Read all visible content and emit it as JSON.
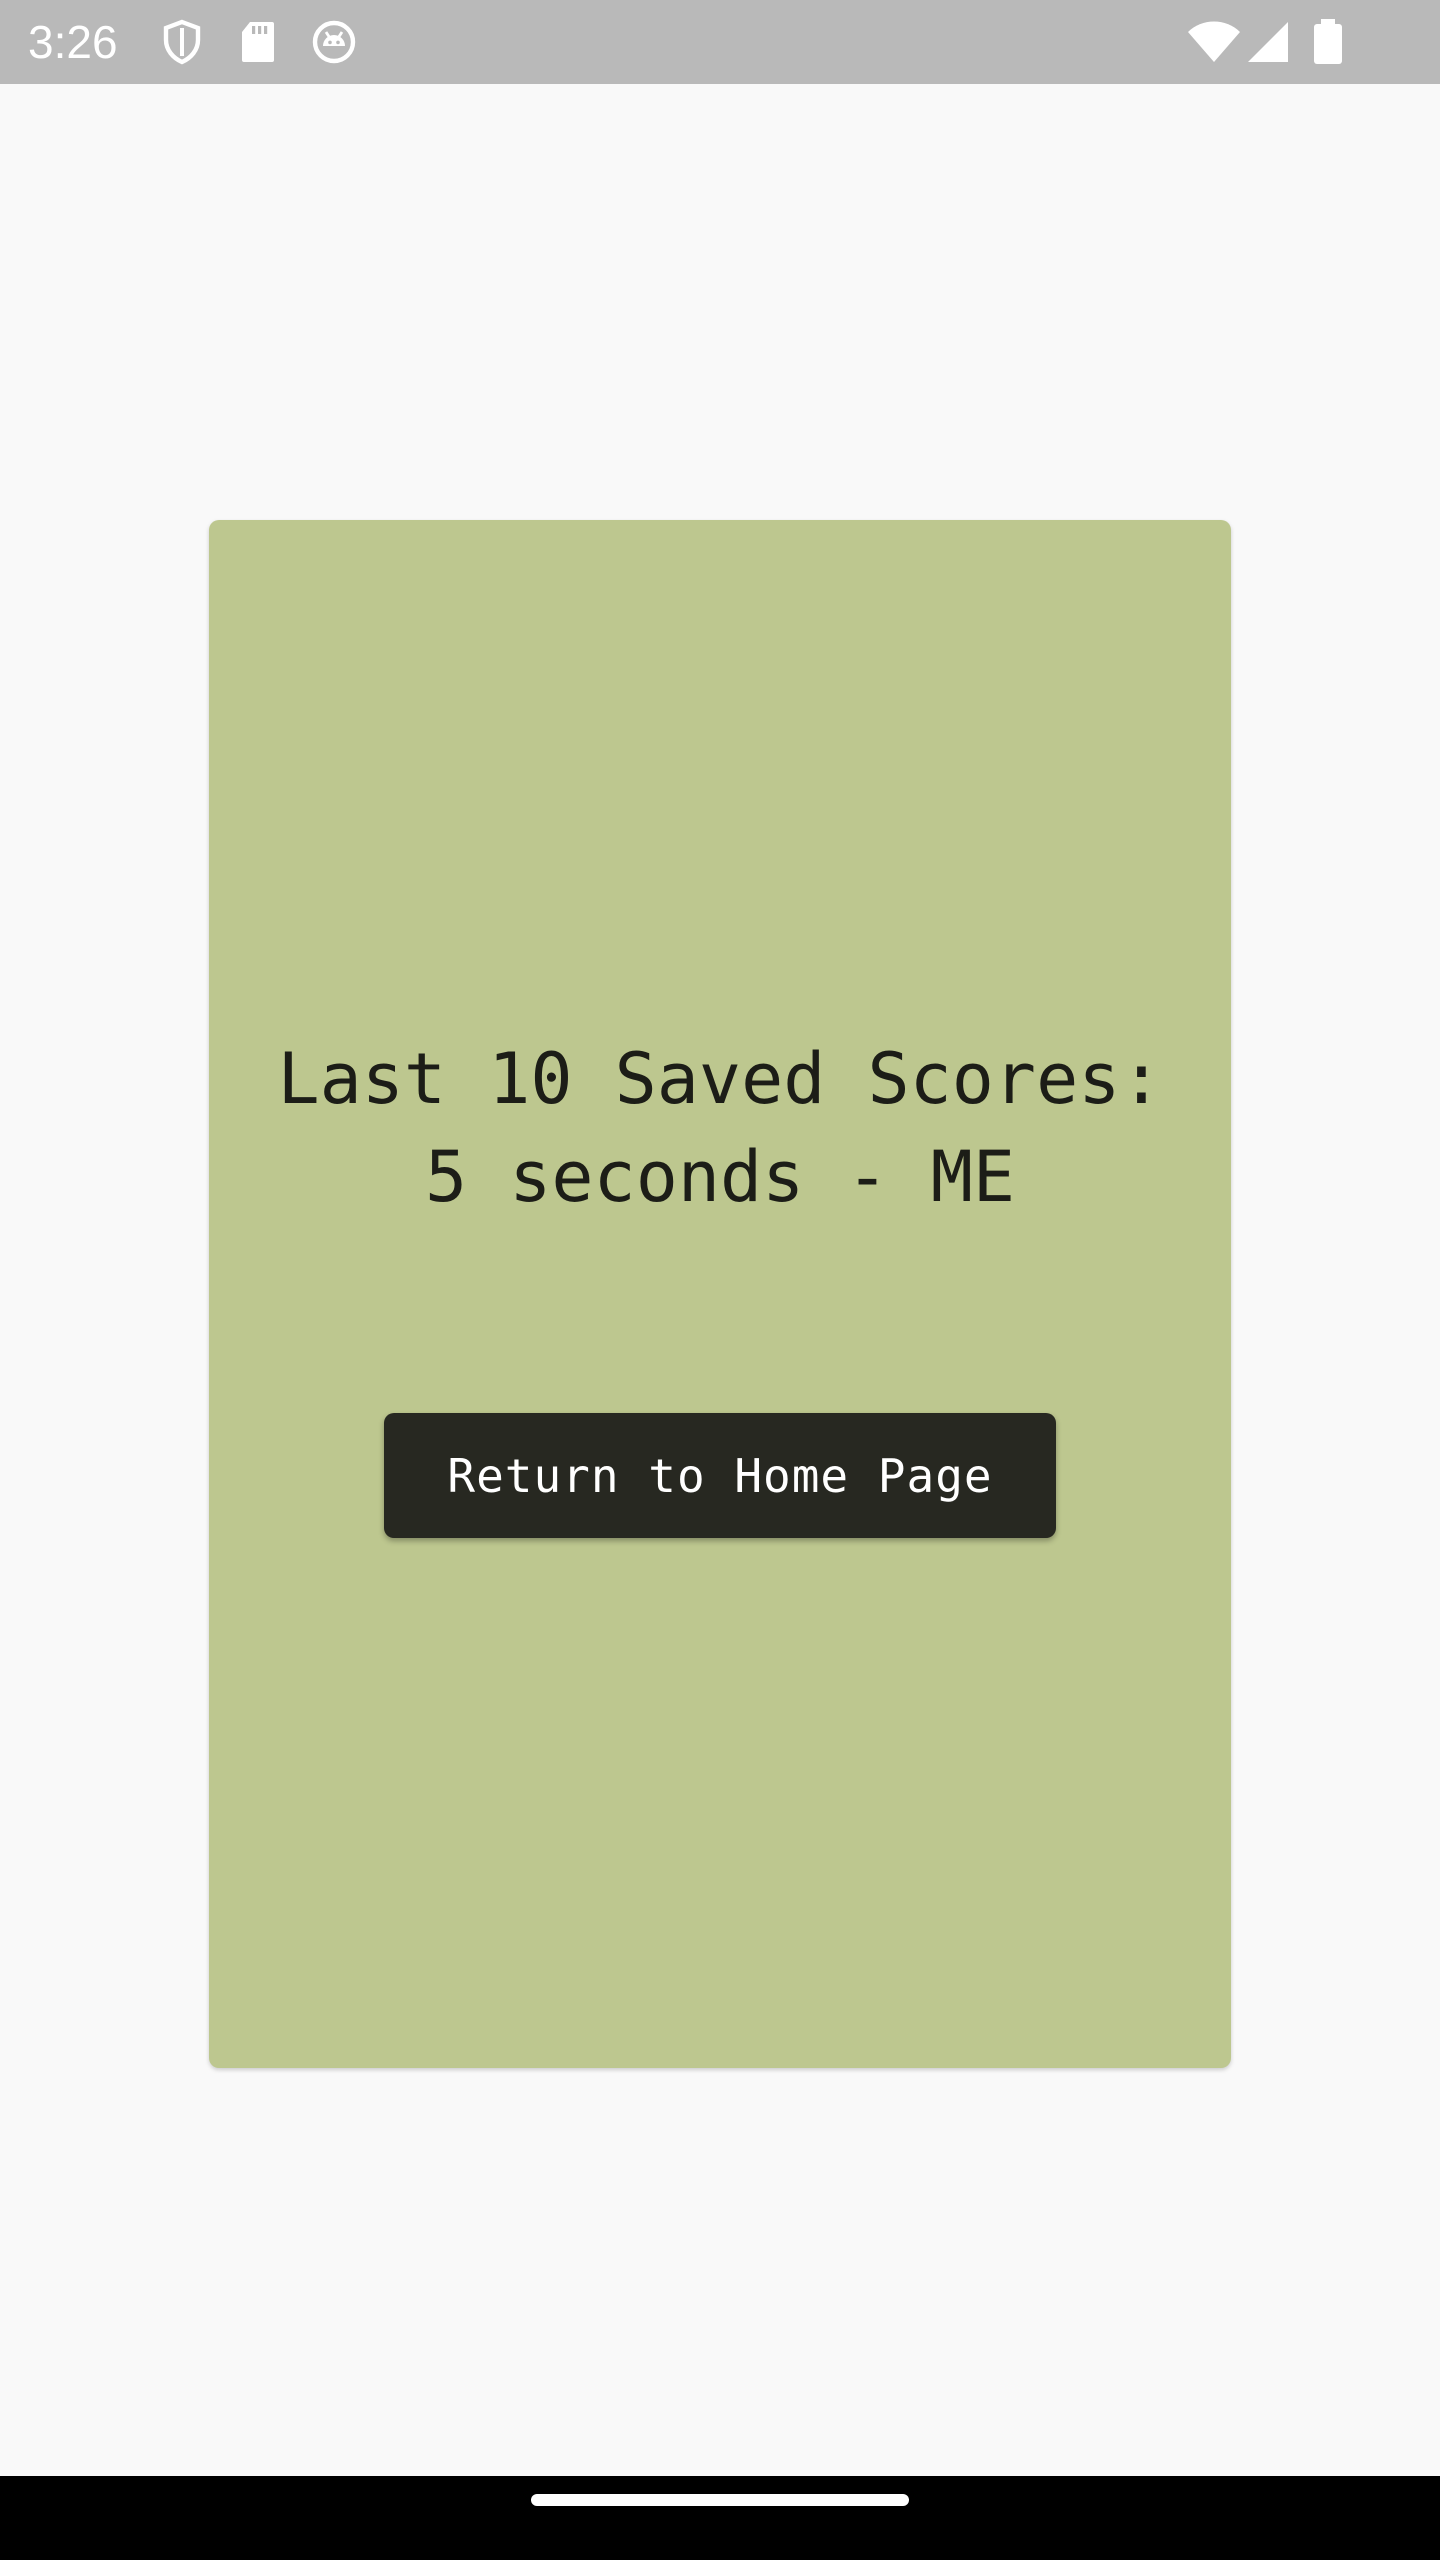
{
  "status_bar": {
    "time": "3:26",
    "icons_left": [
      "shield-icon",
      "sd-card-icon",
      "android-icon"
    ],
    "icons_right": [
      "wifi-icon",
      "signal-icon",
      "battery-icon"
    ]
  },
  "scores": {
    "heading": "Last 10 Saved Scores:",
    "entries": [
      "5 seconds - ME"
    ]
  },
  "actions": {
    "return_home_label": "Return to Home Page"
  },
  "colors": {
    "card_background": "#bdc78f",
    "button_background": "#272821",
    "page_background": "#f9f9f9",
    "status_bar_background": "#b9b9b9"
  }
}
